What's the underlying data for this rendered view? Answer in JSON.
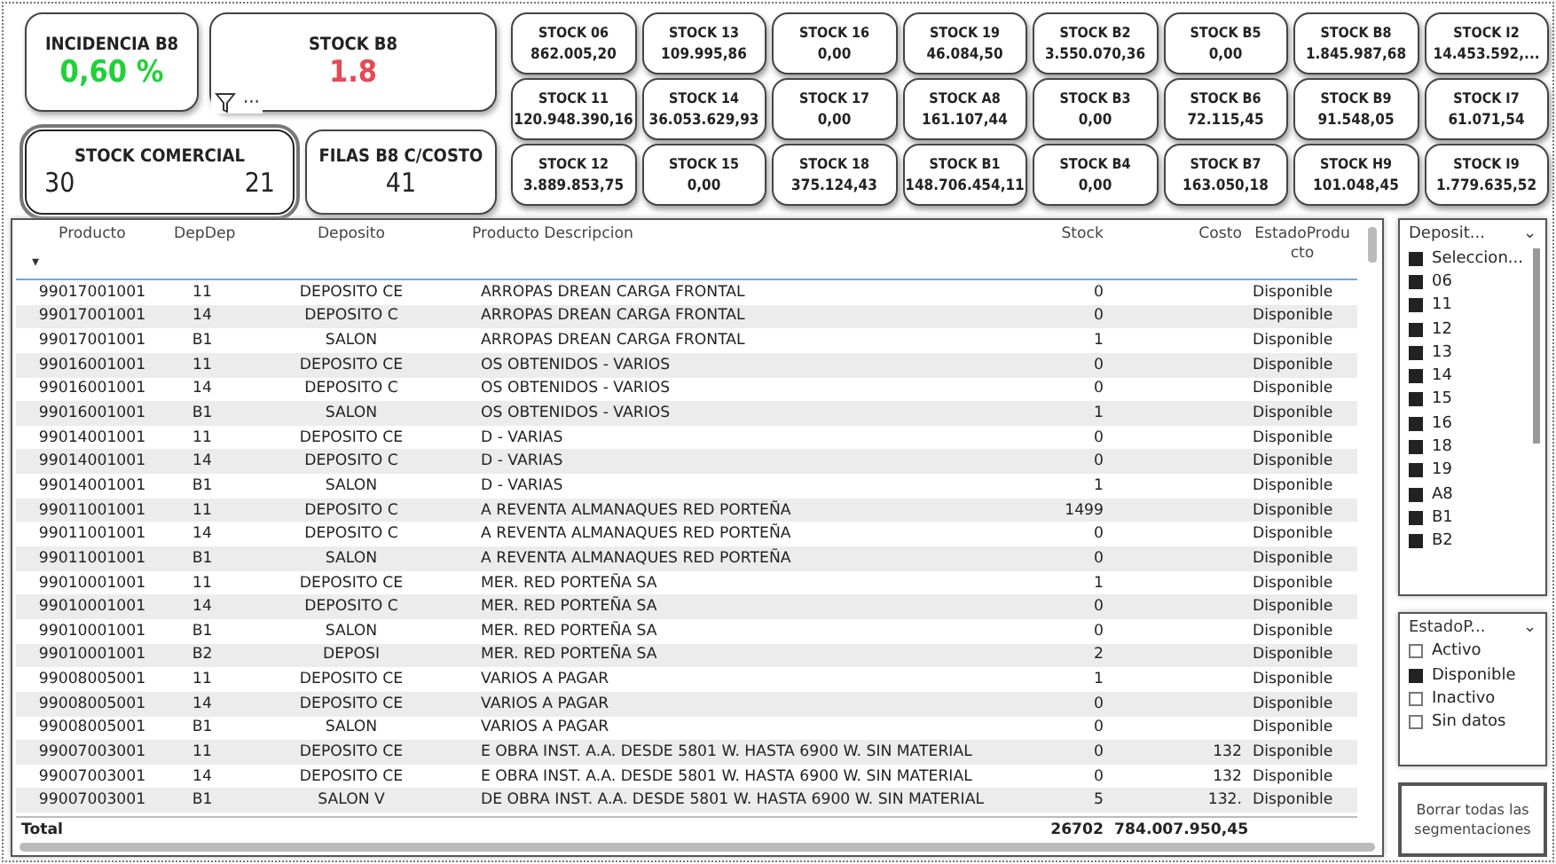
{
  "kpis": [
    {
      "title": "INCIDENCIA B8",
      "value": "0,60 %",
      "color": "#1ed236"
    },
    {
      "title": "STOCK B8",
      "value": "1.8",
      "color": "#e84855"
    }
  ],
  "visual_header": {
    "filter_icon": true,
    "more": "···"
  },
  "kpis_bottom": [
    {
      "title": "STOCK COMERCIAL",
      "value_start": "30",
      "value_end": "21",
      "selected": true
    },
    {
      "title": "FILAS B8 C/COSTO",
      "value": "41",
      "selected": false
    }
  ],
  "stock_cards": [
    {
      "title": "STOCK 06",
      "value": "862.005,20"
    },
    {
      "title": "STOCK 13",
      "value": "109.995,86"
    },
    {
      "title": "STOCK 16",
      "value": "0,00"
    },
    {
      "title": "STOCK 19",
      "value": "46.084,50"
    },
    {
      "title": "STOCK B2",
      "value": "3.550.070,36"
    },
    {
      "title": "STOCK B5",
      "value": "0,00"
    },
    {
      "title": "STOCK B8",
      "value": "1.845.987,68"
    },
    {
      "title": "STOCK I2",
      "value": "14.453.592,..."
    },
    {
      "title": "STOCK 11",
      "value": "120.948.390,16"
    },
    {
      "title": "STOCK 14",
      "value": "36.053.629,93"
    },
    {
      "title": "STOCK 17",
      "value": "0,00"
    },
    {
      "title": "STOCK A8",
      "value": "161.107,44"
    },
    {
      "title": "STOCK B3",
      "value": "0,00"
    },
    {
      "title": "STOCK B6",
      "value": "72.115,45"
    },
    {
      "title": "STOCK B9",
      "value": "91.548,05"
    },
    {
      "title": "STOCK I7",
      "value": "61.071,54"
    },
    {
      "title": "STOCK 12",
      "value": "3.889.853,75"
    },
    {
      "title": "STOCK 15",
      "value": "0,00"
    },
    {
      "title": "STOCK 18",
      "value": "375.124,43"
    },
    {
      "title": "STOCK B1",
      "value": "148.706.454,11"
    },
    {
      "title": "STOCK B4",
      "value": "0,00"
    },
    {
      "title": "STOCK B7",
      "value": "163.050,18"
    },
    {
      "title": "STOCK H9",
      "value": "101.048,45"
    },
    {
      "title": "STOCK I9",
      "value": "1.779.635,52"
    }
  ],
  "table": {
    "columns": [
      "Producto",
      "DepDep",
      "Deposito",
      "Producto Descripcion",
      "Stock",
      "Costo",
      "EstadoProducto"
    ],
    "sort_icon": "▾",
    "rows": [
      {
        "producto": "99017001001",
        "depdep": "11",
        "deposito": "DEPOSITO CE",
        "descripcion": "ARROPAS DREAN CARGA FRONTAL",
        "stock": "0",
        "estado": "Disponible"
      },
      {
        "producto": "99017001001",
        "depdep": "14",
        "deposito": "DEPOSITO C",
        "descripcion": "ARROPAS DREAN CARGA FRONTAL",
        "stock": "0",
        "estado": "Disponible"
      },
      {
        "producto": "99017001001",
        "depdep": "B1",
        "deposito": "SALON",
        "descripcion": "ARROPAS DREAN CARGA FRONTAL",
        "stock": "1",
        "estado": "Disponible"
      },
      {
        "producto": "99016001001",
        "depdep": "11",
        "deposito": "DEPOSITO CE",
        "descripcion": "OS OBTENIDOS - VARIOS",
        "stock": "0",
        "estado": "Disponible"
      },
      {
        "producto": "99016001001",
        "depdep": "14",
        "deposito": "DEPOSITO C",
        "descripcion": "OS OBTENIDOS - VARIOS",
        "stock": "0",
        "estado": "Disponible"
      },
      {
        "producto": "99016001001",
        "depdep": "B1",
        "deposito": "SALON",
        "descripcion": "OS OBTENIDOS - VARIOS",
        "stock": "1",
        "estado": "Disponible"
      },
      {
        "producto": "99014001001",
        "depdep": "11",
        "deposito": "DEPOSITO CE",
        "descripcion": "D - VARIAS",
        "stock": "0",
        "estado": "Disponible"
      },
      {
        "producto": "99014001001",
        "depdep": "14",
        "deposito": "DEPOSITO C",
        "descripcion": "D - VARIAS",
        "stock": "0",
        "estado": "Disponible"
      },
      {
        "producto": "99014001001",
        "depdep": "B1",
        "deposito": "SALON",
        "descripcion": "D - VARIAS",
        "stock": "1",
        "estado": "Disponible"
      },
      {
        "producto": "99011001001",
        "depdep": "11",
        "deposito": "DEPOSITO C",
        "descripcion": "A REVENTA ALMANAQUES RED PORTEÑA",
        "stock": "1499",
        "estado": "Disponible"
      },
      {
        "producto": "99011001001",
        "depdep": "14",
        "deposito": "DEPOSITO C",
        "descripcion": "A REVENTA ALMANAQUES RED PORTEÑA",
        "stock": "0",
        "estado": "Disponible"
      },
      {
        "producto": "99011001001",
        "depdep": "B1",
        "deposito": "SALON",
        "descripcion": "A REVENTA ALMANAQUES RED PORTEÑA",
        "stock": "0",
        "estado": "Disponible"
      },
      {
        "producto": "99010001001",
        "depdep": "11",
        "deposito": "DEPOSITO CE",
        "descripcion": "MER. RED PORTEÑA SA",
        "stock": "1",
        "estado": "Disponible"
      },
      {
        "producto": "99010001001",
        "depdep": "14",
        "deposito": "DEPOSITO C",
        "descripcion": "MER. RED PORTEÑA SA",
        "stock": "0",
        "estado": "Disponible"
      },
      {
        "producto": "99010001001",
        "depdep": "B1",
        "deposito": "SALON",
        "descripcion": "MER. RED PORTEÑA SA",
        "stock": "0",
        "estado": "Disponible"
      },
      {
        "producto": "99010001001",
        "depdep": "B2",
        "deposito": "DEPOSI",
        "descripcion": "MER. RED PORTEÑA SA",
        "stock": "2",
        "estado": "Disponible"
      },
      {
        "producto": "99008005001",
        "depdep": "11",
        "deposito": "DEPOSITO CE",
        "descripcion": "VARIOS A PAGAR",
        "stock": "1",
        "estado": "Disponible"
      },
      {
        "producto": "99008005001",
        "depdep": "14",
        "deposito": "DEPOSITO CE",
        "descripcion": "VARIOS A PAGAR",
        "stock": "0",
        "estado": "Disponible"
      },
      {
        "producto": "99008005001",
        "depdep": "B1",
        "deposito": "SALON",
        "descripcion": "VARIOS A PAGAR",
        "stock": "0",
        "estado": "Disponible"
      },
      {
        "producto": "99007003001",
        "depdep": "11",
        "deposito": "DEPOSITO CE",
        "descripcion": "E OBRA INST. A.A. DESDE 5801 W. HASTA 6900 W. SIN MATERIAL",
        "stock": "0",
        "costo": "132",
        "estado": "Disponible"
      },
      {
        "producto": "99007003001",
        "depdep": "14",
        "deposito": "DEPOSITO CE",
        "descripcion": "E OBRA INST. A.A. DESDE 5801 W. HASTA 6900 W. SIN MATERIAL",
        "stock": "0",
        "costo": "132",
        "estado": "Disponible"
      },
      {
        "producto": "99007003001",
        "depdep": "B1",
        "deposito": "SALON V",
        "descripcion": "DE OBRA INST. A.A. DESDE 5801 W. HASTA 6900 W. SIN MATERIAL",
        "stock": "5",
        "costo": "132.",
        "estado": "Disponible"
      }
    ],
    "total": {
      "label": "Total",
      "stock": "26702",
      "costo": "784.007.950,45"
    }
  },
  "slicers": [
    {
      "title": "Deposit...",
      "chevron": "⌄",
      "scrollbar": true,
      "items": [
        {
          "label": "Seleccion...",
          "checked": true
        },
        {
          "label": "06",
          "checked": true
        },
        {
          "label": "11",
          "checked": true
        },
        {
          "label": "12",
          "checked": true
        },
        {
          "label": "13",
          "checked": true
        },
        {
          "label": "14",
          "checked": true
        },
        {
          "label": "15",
          "checked": true
        },
        {
          "label": "16",
          "checked": true
        },
        {
          "label": "18",
          "checked": true
        },
        {
          "label": "19",
          "checked": true
        },
        {
          "label": "A8",
          "checked": true
        },
        {
          "label": "B1",
          "checked": true
        },
        {
          "label": "B2",
          "checked": true
        }
      ]
    },
    {
      "title": "EstadoP...",
      "chevron": "⌄",
      "scrollbar": false,
      "items": [
        {
          "label": "Activo",
          "checked": false
        },
        {
          "label": "Disponible",
          "checked": true
        },
        {
          "label": "Inactivo",
          "checked": false
        },
        {
          "label": "Sin datos",
          "checked": false
        }
      ]
    }
  ],
  "clear_button": "Borrar todas las segmentaciones"
}
